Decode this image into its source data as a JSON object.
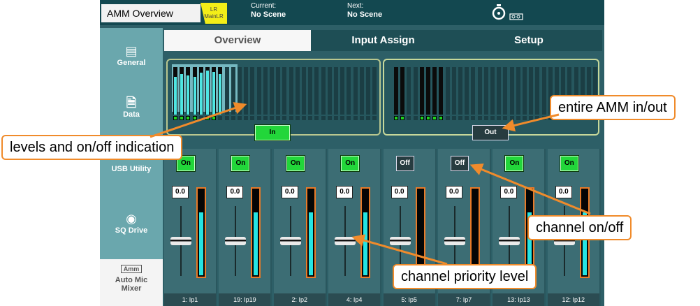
{
  "topbar": {
    "app_title": "AMM Overview",
    "badge_line1": "LR",
    "badge_line2": "MainLR",
    "current_label": "Current:",
    "current_value": "No Scene",
    "next_label": "Next:",
    "next_value": "No Scene"
  },
  "tabs": {
    "overview": "Overview",
    "input_assign": "Input Assign",
    "setup": "Setup"
  },
  "sidebar": {
    "general": "General",
    "data": "Data",
    "usb": "USB Utility",
    "sqdrive": "SQ Drive",
    "amm_logo": "Amm",
    "amm_line1": "Auto Mic",
    "amm_line2": "Mixer"
  },
  "amm": {
    "in_label": "In",
    "out_label": "Out"
  },
  "meters_in": {
    "levels": [
      0.8,
      0.85,
      0.82,
      0.8,
      0.88,
      0.92,
      0.9,
      0.86,
      0,
      0,
      0,
      0,
      0,
      0,
      0,
      0,
      0,
      0,
      0,
      0,
      0,
      0,
      0,
      0,
      0,
      0,
      0,
      0,
      0,
      0,
      0,
      0
    ],
    "active": [
      true,
      true,
      true,
      true,
      true,
      true,
      true,
      true,
      false,
      false,
      false,
      false,
      false,
      false,
      false,
      false,
      false,
      false,
      false,
      false,
      false,
      false,
      false,
      false,
      false,
      false,
      false,
      false,
      false,
      false,
      false,
      false
    ],
    "leds": [
      true,
      true,
      true,
      true,
      false,
      true,
      true,
      false,
      false,
      false,
      false,
      false,
      false,
      false,
      false,
      false,
      false,
      false,
      false,
      false,
      false,
      false,
      false,
      false,
      false,
      false,
      false,
      false,
      false,
      false,
      false,
      false
    ]
  },
  "meters_out": {
    "active": [
      true,
      true,
      false,
      false,
      true,
      true,
      true,
      true,
      false,
      false,
      false,
      false,
      false,
      false,
      false,
      false,
      false,
      false,
      false,
      false,
      false,
      false,
      false,
      false,
      false,
      false,
      false,
      false,
      false,
      false,
      false,
      false
    ],
    "leds": [
      true,
      true,
      false,
      false,
      true,
      true,
      true,
      true,
      false,
      false,
      false,
      false,
      false,
      false,
      false,
      false,
      false,
      false,
      false,
      false,
      false,
      false,
      false,
      false,
      false,
      false,
      false,
      false,
      false,
      false,
      false,
      false
    ]
  },
  "channels": [
    {
      "name": "1: Ip1",
      "state": "On",
      "on": true,
      "value": "0.0",
      "meter": 0.75,
      "priority": 0.5
    },
    {
      "name": "19: Ip19",
      "state": "On",
      "on": true,
      "value": "0.0",
      "meter": 0.75,
      "priority": 0.5
    },
    {
      "name": "2: Ip2",
      "state": "On",
      "on": true,
      "value": "0.0",
      "meter": 0.75,
      "priority": 0.5
    },
    {
      "name": "4: Ip4",
      "state": "On",
      "on": true,
      "value": "0.0",
      "meter": 0.75,
      "priority": 0.5
    },
    {
      "name": "5: Ip5",
      "state": "Off",
      "on": false,
      "value": "0.0",
      "meter": 0,
      "priority": 0.5
    },
    {
      "name": "7: Ip7",
      "state": "Off",
      "on": false,
      "value": "0.0",
      "meter": 0,
      "priority": 0.5
    },
    {
      "name": "13: Ip13",
      "state": "On",
      "on": true,
      "value": "0.0",
      "meter": 0.75,
      "priority": 0.5
    },
    {
      "name": "12: Ip12",
      "state": "On",
      "on": true,
      "value": "0.0",
      "meter": 0.75,
      "priority": 0.5
    }
  ],
  "callouts": {
    "levels": "levels and on/off indication",
    "entire": "entire AMM in/out",
    "chan_onoff": "channel on/off",
    "priority": "channel priority level"
  },
  "colors": {
    "callout_border": "#f08b2b",
    "on_green": "#22d63a",
    "meter_cyan": "#25e4e2",
    "badge_yellow": "#f3ee18"
  }
}
